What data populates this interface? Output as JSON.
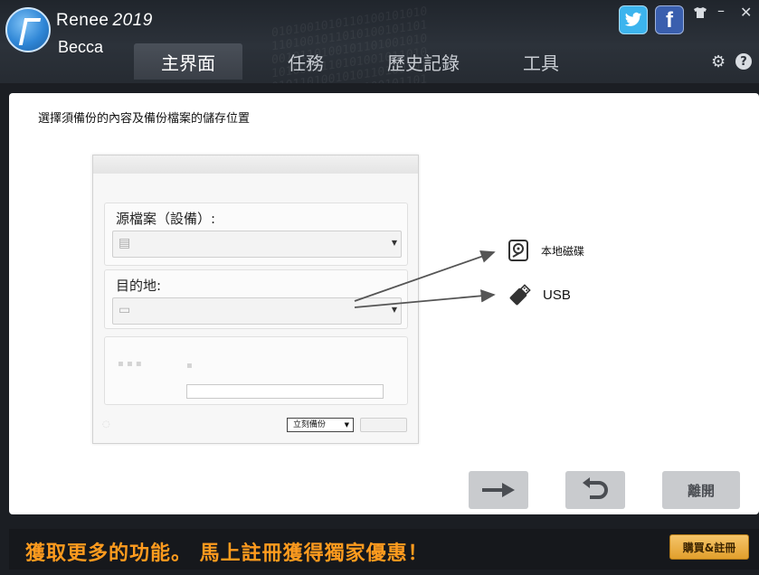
{
  "app": {
    "name": "Renee",
    "version": "2019",
    "user": "Becca"
  },
  "tabs": [
    {
      "label": "主界面",
      "active": true
    },
    {
      "label": "任務",
      "active": false
    },
    {
      "label": "歷史記錄",
      "active": false
    },
    {
      "label": "工具",
      "active": false
    }
  ],
  "header_icons": {
    "twitter": "t",
    "facebook": "f",
    "help": "?"
  },
  "main": {
    "instruction": "選擇須備份的內容及備份檔案的儲存位置",
    "preview": {
      "source_label": "源檔案（設備）:",
      "destination_label": "目的地:",
      "backup_select": "立刻備份"
    },
    "targets": {
      "local_disk": "本地磁碟",
      "usb": "USB"
    },
    "buttons": {
      "next_icon": "arrow-right-icon",
      "back_icon": "undo-icon",
      "exit": "離開"
    }
  },
  "footer": {
    "promo": "獲取更多的功能。 馬上註冊獲得獨家優惠！",
    "register": "購買&註冊"
  },
  "colors": {
    "accent_orange": "#ff9b1e",
    "header_bg": "#2c323a",
    "button_gray": "#c9cbce"
  }
}
